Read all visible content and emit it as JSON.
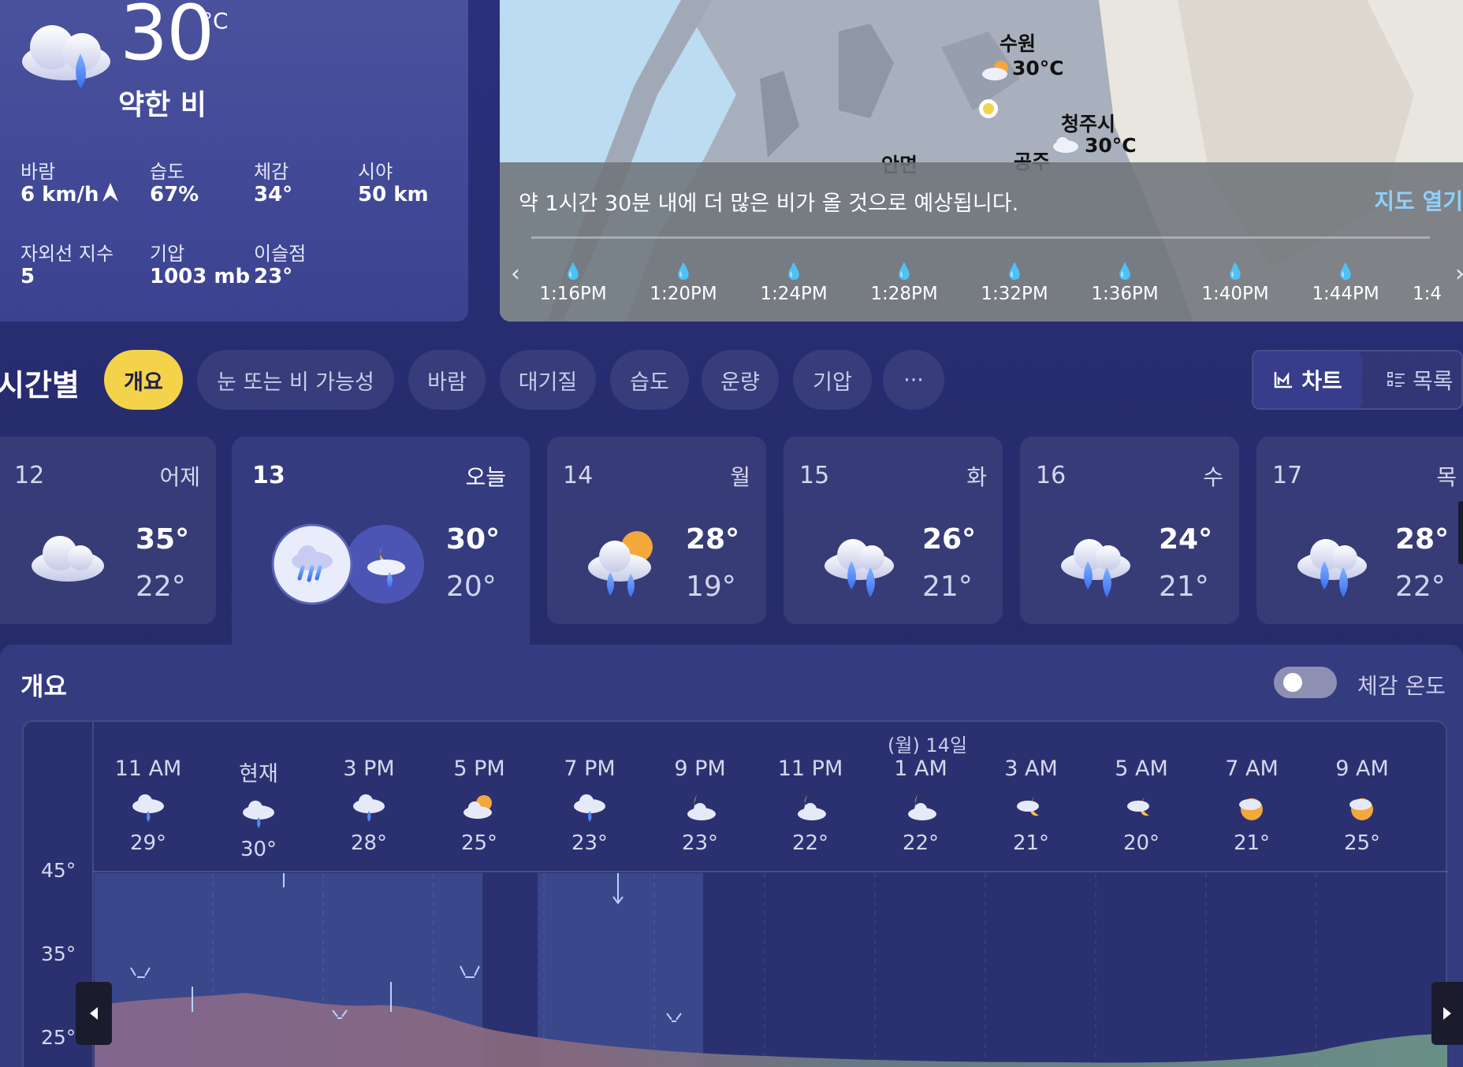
{
  "current": {
    "temperature": "30",
    "unit": "°C",
    "condition": "약한 비",
    "stats": [
      {
        "label": "바람",
        "value": "6 km/h"
      },
      {
        "label": "습도",
        "value": "67%"
      },
      {
        "label": "체감",
        "value": "34°"
      },
      {
        "label": "시야",
        "value": "50 km"
      },
      {
        "label": "자외선 지수",
        "value": "5"
      },
      {
        "label": "기압",
        "value": "1003 mb"
      },
      {
        "label": "이슬점",
        "value": "23°"
      }
    ]
  },
  "map": {
    "message": "약 1시간 30분 내에 더 많은 비가 올 것으로 예상됩니다.",
    "open_link": "지도 열기",
    "cities": [
      {
        "name": "수원",
        "temp": "30°C"
      },
      {
        "name": "청주시",
        "temp": "30°C"
      },
      {
        "name": "안면",
        "temp": ""
      },
      {
        "name": "공주",
        "temp": ""
      }
    ],
    "timeline": [
      "1:16PM",
      "1:20PM",
      "1:24PM",
      "1:28PM",
      "1:32PM",
      "1:36PM",
      "1:40PM",
      "1:44PM",
      "1:4"
    ]
  },
  "hourly": {
    "title": "시간별",
    "tabs": [
      "개요",
      "눈 또는 비 가능성",
      "바람",
      "대기질",
      "습도",
      "운량",
      "기압",
      "···"
    ],
    "view_chart": "차트",
    "view_list": "목록"
  },
  "days": [
    {
      "num": "12",
      "name": "어제",
      "high": "35°",
      "low": "22°",
      "icon": "cloudy-icon"
    },
    {
      "num": "13",
      "name": "오늘",
      "high": "30°",
      "low": "20°",
      "icon": "rain-cloud-icon"
    },
    {
      "num": "14",
      "name": "월",
      "high": "28°",
      "low": "19°",
      "icon": "sun-rain-icon"
    },
    {
      "num": "15",
      "name": "화",
      "high": "26°",
      "low": "21°",
      "icon": "rain-cloud-icon"
    },
    {
      "num": "16",
      "name": "수",
      "high": "24°",
      "low": "21°",
      "icon": "rain-cloud-icon"
    },
    {
      "num": "17",
      "name": "목",
      "high": "28°",
      "low": "22°",
      "icon": "rain-cloud-icon"
    }
  ],
  "overview": {
    "title": "개요",
    "feels_like_label": "체감 온도",
    "next_day_label": "(월) 14일",
    "hours": [
      {
        "time": "11 AM",
        "temp": "29°",
        "icon": "rain-cloud-icon"
      },
      {
        "time": "현재",
        "temp": "30°",
        "icon": "rain-cloud-icon"
      },
      {
        "time": "3 PM",
        "temp": "28°",
        "icon": "rain-cloud-icon"
      },
      {
        "time": "5 PM",
        "temp": "25°",
        "icon": "partly-cloudy-icon"
      },
      {
        "time": "7 PM",
        "temp": "23°",
        "icon": "rain-cloud-icon"
      },
      {
        "time": "9 PM",
        "temp": "23°",
        "icon": "night-cloudy-icon"
      },
      {
        "time": "11 PM",
        "temp": "22°",
        "icon": "night-cloudy-icon"
      },
      {
        "time": "1 AM",
        "temp": "22°",
        "icon": "night-cloudy-icon"
      },
      {
        "time": "3 AM",
        "temp": "21°",
        "icon": "night-cloudy-icon"
      },
      {
        "time": "5 AM",
        "temp": "20°",
        "icon": "night-cloudy-icon"
      },
      {
        "time": "7 AM",
        "temp": "21°",
        "icon": "partly-cloudy-icon"
      },
      {
        "time": "9 AM",
        "temp": "25°",
        "icon": "partly-cloudy-icon"
      }
    ],
    "y_axis": [
      "45°",
      "35°",
      "25°"
    ]
  }
}
